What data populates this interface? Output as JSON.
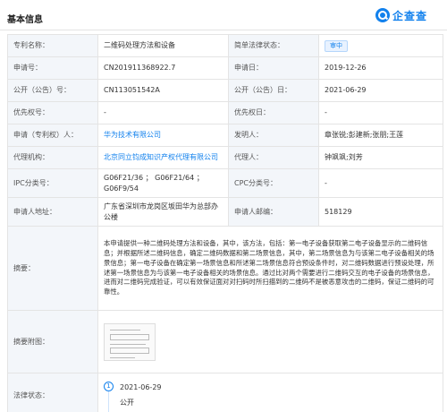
{
  "header": {
    "title": "基本信息",
    "logo_text": "企查查"
  },
  "rows": {
    "name_label": "专利名称：",
    "name_value": "二维码处理方法和设备",
    "status_label": "简单法律状态：",
    "status_value": "审中",
    "app_no_label": "申请号：",
    "app_no_value": "CN201911368922.7",
    "app_date_label": "申请日：",
    "app_date_value": "2019-12-26",
    "pub_no_label": "公开（公告）号：",
    "pub_no_value": "CN113051542A",
    "pub_date_label": "公开（公告）日：",
    "pub_date_value": "2021-06-29",
    "priority_no_label": "优先权号：",
    "priority_no_value": "-",
    "priority_date_label": "优先权日：",
    "priority_date_value": "-",
    "applicant_label": "申请（专利权）人：",
    "applicant_value": "华为技术有限公司",
    "inventor_label": "发明人：",
    "inventor_value": "章张锐;彭建新;张朋;王莲",
    "agency_label": "代理机构：",
    "agency_value": "北京同立钧成知识产权代理有限公司",
    "agent_label": "代理人：",
    "agent_value": "钟飒飒;刘芳",
    "ipc_label": "IPC分类号：",
    "ipc_value": "G06F21/36 ； G06F21/64 ； G06F9/54",
    "cpc_label": "CPC分类号：",
    "cpc_value": "-",
    "address_label": "申请人地址：",
    "address_value": "广东省深圳市龙岗区坂田华为总部办公楼",
    "postcode_label": "申请人邮编：",
    "postcode_value": "518129",
    "abstract_label": "摘要：",
    "abstract_value": "本申请提供一种二维码处理方法和设备，其中，该方法，包括：第一电子设备获取第二电子设备显示的二维码信息；并根据所述二维码信息，确定二维码数据和第二场景信息，其中，第二场景信息为与该第二电子设备相关的场景信息；第一电子设备在确定第一场景信息和所述第二场景信息符合预设条件时，对二维码数据进行预设处理，所述第一场景信息为与该第一电子设备相关的场景信息。通过比对两个需要进行二维码交互的电子设备的场景信息，进而对二维码完成验证，可以有效保证面对对扫码时所扫描到的二维码不是被恶意攻击的二维码，保证二维码的可靠性。",
    "figure_label": "摘要附图：",
    "legal_label": "法律状态：",
    "legal_index": "1",
    "legal_date": "2021-06-29",
    "legal_status": "公开"
  },
  "colors": {
    "accent": "#1281ed",
    "label_bg": "#f3f6fa",
    "border": "#e4e4e4"
  }
}
